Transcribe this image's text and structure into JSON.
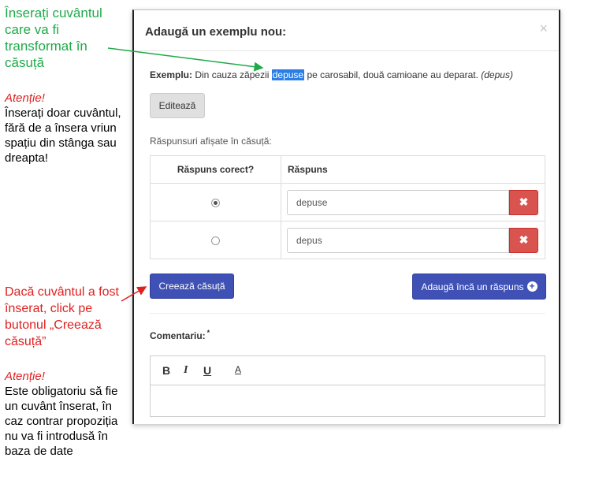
{
  "annotations": {
    "green": "Înserați cuvântul care va fi transformat în căsuță",
    "attention1_title": "Atenție!",
    "attention1_text": "Înserați doar cuvântul, fără de a însera vriun spațiu din stânga sau dreapta!",
    "red_instruction": "Dacă cuvântul a fost înserat, click pe butonul „Creează căsuță”",
    "attention2_title": "Atenție!",
    "attention2_text": "Este obligatoriu să fie un cuvânt înserat, în caz contrar propoziția nu va fi introdusă în baza de date",
    "colors": {
      "green": "#1faa4a",
      "red": "#e02020"
    }
  },
  "modal": {
    "title": "Adaugă un exemplu nou:",
    "close_icon": "close-icon",
    "example_label": "Exemplu:",
    "example_before": " Din cauza zăpezii ",
    "example_highlight": "depuse",
    "example_after": " pe carosabil, două camioane au deparat. ",
    "example_hint": "(depus)",
    "edit_button": "Editează",
    "answers_label": "Răspunsuri afișate în căsuță:",
    "table_headers": [
      "Răspuns corect?",
      "Răspuns"
    ],
    "answers": [
      {
        "correct": true,
        "value": "depuse"
      },
      {
        "correct": false,
        "value": "depus"
      }
    ],
    "delete_icon": "times-icon",
    "create_button": "Creează căsuță",
    "add_button": "Adaugă încă un răspuns",
    "add_icon": "plus-circle-icon",
    "comment_label": "Comentariu:",
    "required_mark": "*",
    "toolbar": {
      "bold": "B",
      "italic": "I",
      "underline": "U",
      "color": "A"
    },
    "colors": {
      "primary": "#3f51b5",
      "danger": "#d9534f",
      "highlight": "#2a7ee8"
    }
  }
}
